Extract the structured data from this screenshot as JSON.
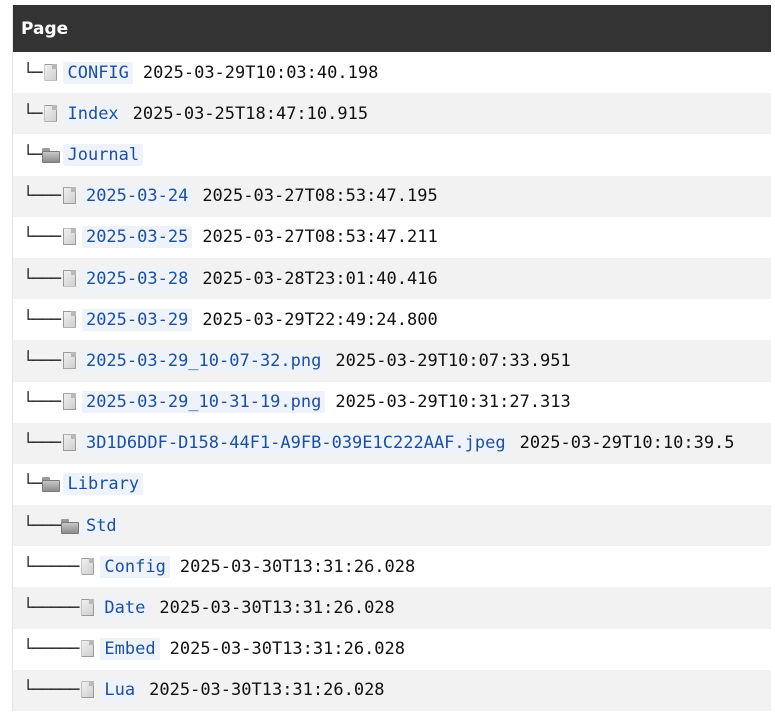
{
  "table": {
    "header": "Page"
  },
  "rows": [
    {
      "prefix": "└─",
      "icon": "file-icon",
      "name": "CONFIG",
      "ts": "2025-03-29T10:03:40.198"
    },
    {
      "prefix": "└─",
      "icon": "file-icon",
      "name": "Index",
      "ts": "2025-03-25T18:47:10.915"
    },
    {
      "prefix": "└─",
      "icon": "folder-icon",
      "name": "Journal",
      "ts": ""
    },
    {
      "prefix": "└───",
      "icon": "file-icon",
      "name": "2025-03-24",
      "ts": "2025-03-27T08:53:47.195"
    },
    {
      "prefix": "└───",
      "icon": "file-icon",
      "name": "2025-03-25",
      "ts": "2025-03-27T08:53:47.211"
    },
    {
      "prefix": "└───",
      "icon": "file-icon",
      "name": "2025-03-28",
      "ts": "2025-03-28T23:01:40.416"
    },
    {
      "prefix": "└───",
      "icon": "file-icon",
      "name": "2025-03-29",
      "ts": "2025-03-29T22:49:24.800"
    },
    {
      "prefix": "└───",
      "icon": "file-icon",
      "name": "2025-03-29_10-07-32.png",
      "ts": "2025-03-29T10:07:33.951"
    },
    {
      "prefix": "└───",
      "icon": "file-icon",
      "name": "2025-03-29_10-31-19.png",
      "ts": "2025-03-29T10:31:27.313"
    },
    {
      "prefix": "└───",
      "icon": "file-icon",
      "name": "3D1D6DDF-D158-44F1-A9FB-039E1C222AAF.jpeg",
      "ts": "2025-03-29T10:10:39.5"
    },
    {
      "prefix": "└─",
      "icon": "folder-icon",
      "name": "Library",
      "ts": ""
    },
    {
      "prefix": "└───",
      "icon": "folder-icon",
      "name": "Std",
      "ts": ""
    },
    {
      "prefix": "└─────",
      "icon": "file-icon",
      "name": "Config",
      "ts": "2025-03-30T13:31:26.028"
    },
    {
      "prefix": "└─────",
      "icon": "file-icon",
      "name": "Date",
      "ts": "2025-03-30T13:31:26.028"
    },
    {
      "prefix": "└─────",
      "icon": "file-icon",
      "name": "Embed",
      "ts": "2025-03-30T13:31:26.028"
    },
    {
      "prefix": "└─────",
      "icon": "file-icon",
      "name": "Lua",
      "ts": "2025-03-30T13:31:26.028"
    }
  ]
}
